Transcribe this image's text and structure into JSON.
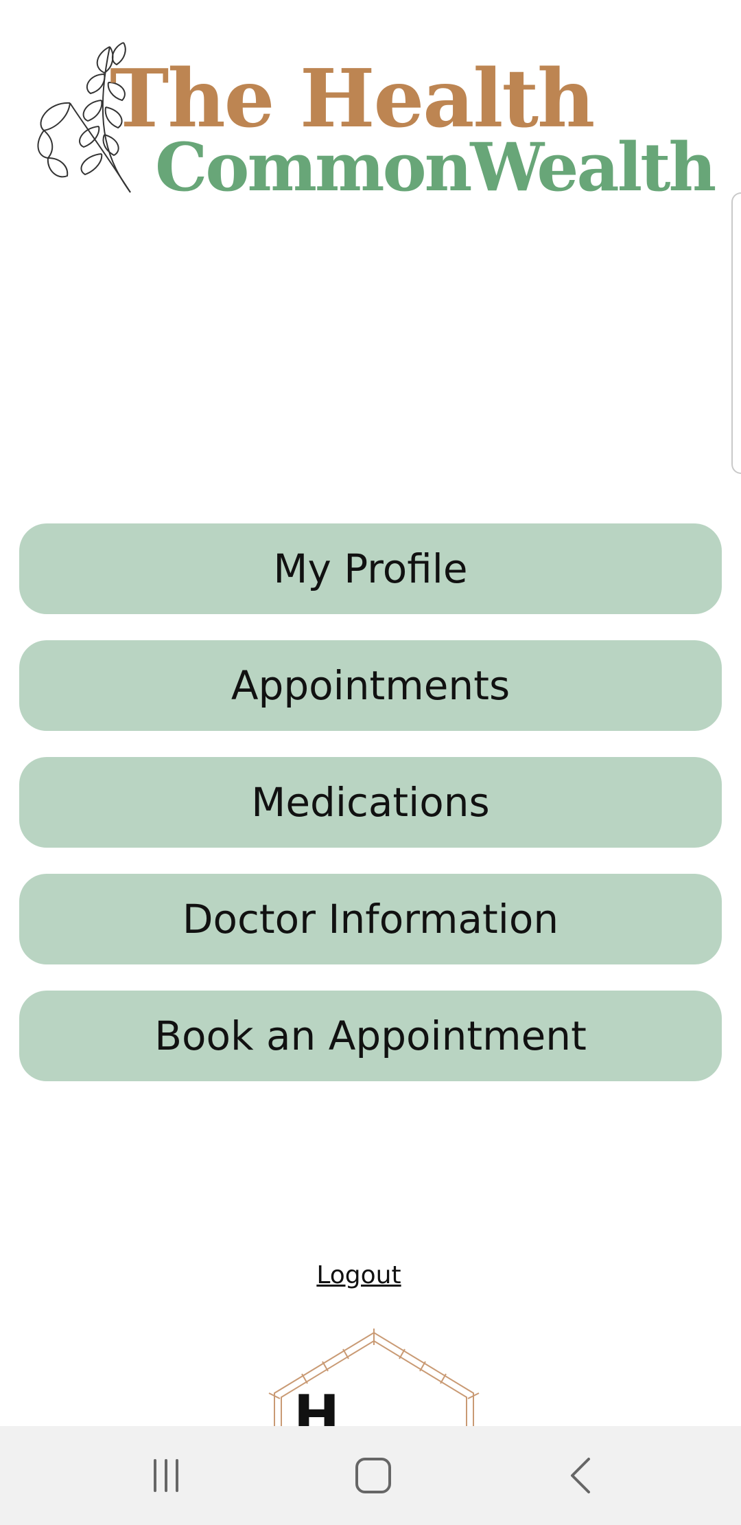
{
  "header": {
    "logo_line1": "The Health",
    "logo_line2": "CommonWealth",
    "brand_colors": {
      "tan": "#bd8552",
      "green": "#68a678"
    }
  },
  "menu": {
    "button_color": "#b9d4c2",
    "items": [
      {
        "label": "My Profile"
      },
      {
        "label": "Appointments"
      },
      {
        "label": "Medications"
      },
      {
        "label": "Doctor Information"
      },
      {
        "label": "Book an Appointment"
      }
    ]
  },
  "logout_label": "Logout",
  "bottom_logo": {
    "visible_letter": "H"
  },
  "navbar": {
    "recent_icon": "recent-apps-icon",
    "home_icon": "home-icon",
    "back_icon": "back-icon"
  }
}
